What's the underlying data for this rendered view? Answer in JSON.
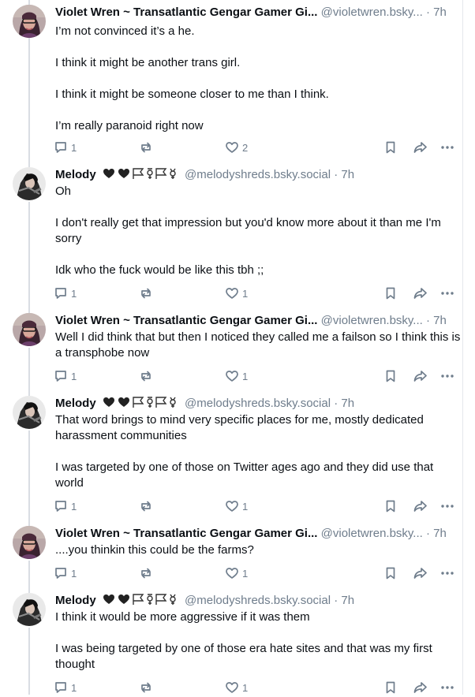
{
  "posts": [
    {
      "author": "Violet Wren ~ Transatlantic Gengar Gamer Gi...",
      "handle": "@violetwren.bsky...",
      "time": "· 7h",
      "paragraphs": [
        "I’m not convinced it’s a he.",
        "I think it might be another trans girl.",
        "I think it might be someone closer to me than I think.",
        "I’m really paranoid right now"
      ],
      "replies": "1",
      "reposts": "",
      "likes": "2"
    },
    {
      "author": "Melody",
      "handle": "@melodyshreds.bsky.social",
      "time": "· 7h",
      "paragraphs": [
        "Oh",
        "I don't really get that impression but you'd know more about it than me I'm sorry",
        "Idk who the fuck would be like this tbh ;;"
      ],
      "replies": "1",
      "reposts": "",
      "likes": "1"
    },
    {
      "author": "Violet Wren ~ Transatlantic Gengar Gamer Gi...",
      "handle": "@violetwren.bsky...",
      "time": "· 7h",
      "paragraphs": [
        "Well I did think that but then I noticed they called me a failson so I think this is a transphobe now"
      ],
      "replies": "1",
      "reposts": "",
      "likes": "1"
    },
    {
      "author": "Melody",
      "handle": "@melodyshreds.bsky.social",
      "time": "· 7h",
      "paragraphs": [
        "That word brings to mind very specific places for me, mostly dedicated harassment communities",
        "I was targeted by one of those on Twitter ages ago and they did use that world"
      ],
      "replies": "1",
      "reposts": "",
      "likes": "1"
    },
    {
      "author": "Violet Wren ~ Transatlantic Gengar Gamer Gi...",
      "handle": "@violetwren.bsky...",
      "time": "· 7h",
      "paragraphs": [
        "....you thinkin this could be the farms?"
      ],
      "replies": "1",
      "reposts": "",
      "likes": "1"
    },
    {
      "author": "Melody",
      "handle": "@melodyshreds.bsky.social",
      "time": "· 7h",
      "paragraphs": [
        "I think it would be more aggressive if it was them",
        "I was being targeted by one of those era hate sites and that was my first thought"
      ],
      "replies": "1",
      "reposts": "",
      "likes": "1"
    }
  ],
  "icons": {
    "reply": "speech-bubble-icon",
    "repost": "repost-arrows-icon",
    "like": "heart-icon",
    "bookmark": "bookmark-icon",
    "share": "share-arrow-icon",
    "more": "ellipsis-icon",
    "melody_badges": "black-hearts-and-flags-icon"
  },
  "colors": {
    "muted": "#6f7d8c",
    "text": "#0b0f14",
    "thread_line": "#d9dde3"
  }
}
